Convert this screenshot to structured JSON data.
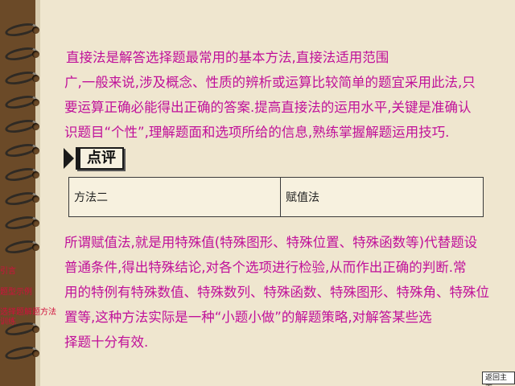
{
  "paragraph1": [
    "直接法是解答选择题最常用的基本方法,直接法适用范围",
    "广,一般来说,涉及概念、性质的辨析或运算比较简单的题宜采用此法,只",
    "要运算正确必能得出正确的答案.提高直接法的运用水平,关键是准确认",
    "识题目“个性”,理解题面和选项所给的信息,熟练掌握解题运用技巧."
  ],
  "section_label": "点评",
  "table": {
    "left": "方法二",
    "right": "赋值法"
  },
  "paragraph2": [
    "所谓赋值法,就是用特殊值(特殊图形、特殊位置、特殊函数等)代替题设",
    "普通条件,得出特殊结论,对各个选项进行检验,从而作出正确的判断.常",
    "用的特例有特殊数值、特殊数列、特殊函数、特殊图形、特殊角、特殊位",
    "置等,这种方法实际是一种“小题小做”的解题策略,对解答某些选",
    "择题十分有效."
  ],
  "nav": {
    "intro": "引言",
    "example": "题型示例",
    "practice": "选择题解题方法训练"
  },
  "back_button": "返回主页",
  "colors": {
    "text": "#c0109a",
    "nav": "#d0103c",
    "paper": "#efe6cf",
    "background": "#6b4a28"
  }
}
